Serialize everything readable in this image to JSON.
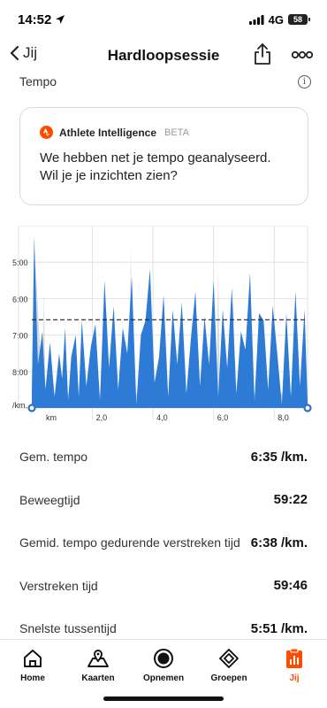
{
  "status_bar": {
    "time": "14:52",
    "network": "4G",
    "battery": "58"
  },
  "nav": {
    "back_label": "Jij",
    "title": "Hardloopsessie"
  },
  "section": {
    "title": "Tempo"
  },
  "ai_card": {
    "name": "Athlete Intelligence",
    "badge": "BETA",
    "message": "We hebben net je tempo geanalyseerd. Wil je je inzichten zien?"
  },
  "chart_data": {
    "type": "area",
    "title": "",
    "xlabel": "km",
    "ylabel": "/km.",
    "y_tick_labels": [
      "5:00",
      "6:00",
      "7:00",
      "8:00",
      "/km."
    ],
    "x_tick_labels": [
      "km",
      "2,0",
      "4,0",
      "6,0",
      "8,0"
    ],
    "x_ticks": [
      2.0,
      4.0,
      6.0,
      8.0
    ],
    "xlim": [
      0,
      9.1
    ],
    "ylim_pace_min": [
      4.0,
      9.0
    ],
    "y_axis_inverted": true,
    "average_pace_min": 6.58,
    "average_line_style": "dashed",
    "series": [
      {
        "style": "fill",
        "color": "#2e7bd6",
        "x": [
          0.0,
          0.08,
          0.2,
          0.35,
          0.45,
          0.6,
          0.75,
          0.9,
          1.0,
          1.1,
          1.2,
          1.3,
          1.45,
          1.55,
          1.65,
          1.8,
          1.95,
          2.1,
          2.25,
          2.4,
          2.55,
          2.7,
          2.85,
          3.0,
          3.15,
          3.3,
          3.45,
          3.6,
          3.75,
          3.9,
          4.05,
          4.2,
          4.35,
          4.5,
          4.65,
          4.8,
          4.95,
          5.1,
          5.25,
          5.4,
          5.55,
          5.7,
          5.85,
          6.0,
          6.15,
          6.3,
          6.45,
          6.6,
          6.75,
          6.9,
          7.05,
          7.2,
          7.35,
          7.5,
          7.65,
          7.8,
          7.95,
          8.1,
          8.25,
          8.4,
          8.55,
          8.7,
          8.85,
          9.0,
          9.1
        ],
        "values": [
          8.6,
          4.3,
          7.8,
          6.9,
          8.5,
          7.2,
          8.7,
          7.5,
          8.2,
          6.8,
          8.8,
          7.6,
          7.0,
          8.7,
          6.6,
          8.4,
          7.3,
          6.7,
          8.8,
          5.5,
          7.9,
          6.2,
          8.5,
          6.8,
          7.5,
          5.4,
          8.9,
          7.0,
          6.6,
          5.2,
          8.3,
          7.6,
          5.9,
          8.7,
          6.3,
          7.8,
          6.1,
          8.6,
          7.1,
          5.8,
          8.4,
          6.5,
          7.8,
          5.5,
          8.7,
          6.3,
          7.9,
          5.7,
          8.6,
          6.9,
          7.4,
          5.3,
          8.8,
          6.4,
          6.6,
          8.5,
          6.2,
          7.5,
          8.9,
          6.4,
          8.7,
          5.8,
          8.4,
          6.3,
          8.8
        ]
      },
      {
        "style": "fill",
        "color": "#d9d9d9",
        "x": [
          0.0,
          0.08,
          0.35,
          0.4,
          0.45,
          3.2,
          3.27,
          3.34,
          6.1,
          6.15,
          6.2,
          6.6,
          6.65,
          6.7,
          9.1
        ],
        "values": [
          8.6,
          4.3,
          8.6,
          5.8,
          8.6,
          8.6,
          4.6,
          8.6,
          8.6,
          5.1,
          8.6,
          8.6,
          5.6,
          8.6,
          8.6
        ]
      }
    ]
  },
  "stats": [
    {
      "label": "Gem. tempo",
      "value": "6:35 /km."
    },
    {
      "label": "Beweegtijd",
      "value": "59:22"
    },
    {
      "label": "Gemid. tempo gedurende verstreken tijd",
      "value": "6:38 /km."
    },
    {
      "label": "Verstreken tijd",
      "value": "59:46"
    },
    {
      "label": "Snelste tussentijd",
      "value": "5:51 /km."
    }
  ],
  "tab_bar": {
    "items": [
      {
        "label": "Home",
        "icon": "home-icon"
      },
      {
        "label": "Kaarten",
        "icon": "map-icon"
      },
      {
        "label": "Opnemen",
        "icon": "record-icon"
      },
      {
        "label": "Groepen",
        "icon": "groups-icon"
      },
      {
        "label": "Jij",
        "icon": "profile-icon",
        "active": true
      }
    ],
    "active_color": "#fc4c02"
  }
}
